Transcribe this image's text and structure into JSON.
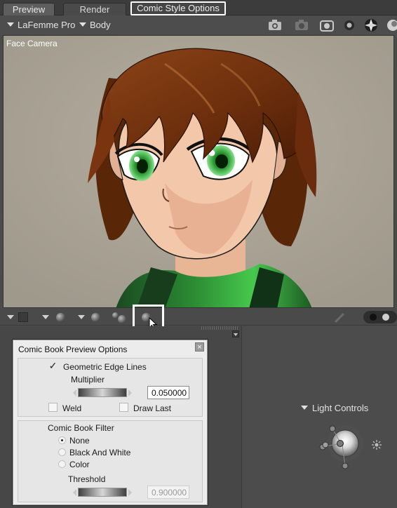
{
  "tabs": [
    "Preview",
    "Render",
    "Comic Style Options"
  ],
  "figure_selector": {
    "figure": "LaFemme Pro",
    "part": "Body"
  },
  "viewport": {
    "camera_label": "Face Camera"
  },
  "dialog": {
    "title": "Comic Book Preview Options",
    "close_glyph": "×",
    "geometric_edge_lines": {
      "label": "Geometric Edge Lines",
      "checked": true,
      "check_glyph": "✓"
    },
    "multiplier": {
      "label": "Multiplier",
      "value": "0.050000"
    },
    "weld": {
      "label": "Weld",
      "checked": false
    },
    "draw_last": {
      "label": "Draw Last",
      "checked": false
    },
    "comic_book_filter": {
      "label": "Comic Book Filter",
      "options": [
        "None",
        "Black And White",
        "Color"
      ],
      "selected": "None"
    },
    "threshold": {
      "label": "Threshold",
      "value": "0.900000"
    }
  },
  "light_controls": {
    "label": "Light Controls"
  }
}
